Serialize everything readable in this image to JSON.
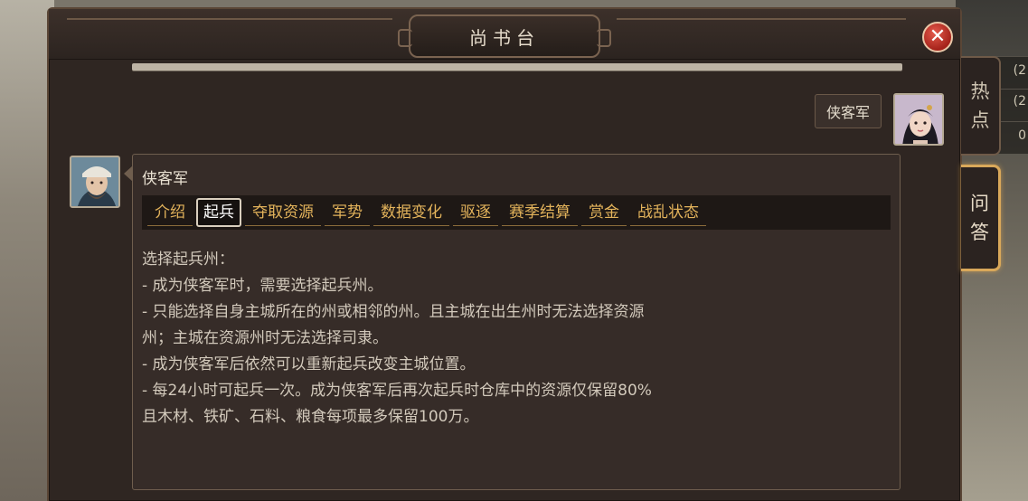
{
  "window": {
    "title": "尚书台",
    "close_label": "✕"
  },
  "side_tabs": {
    "hot": [
      "热",
      "点"
    ],
    "qa": [
      "问",
      "答"
    ]
  },
  "background": {
    "right_numbers": [
      "(2",
      "(2",
      "0"
    ]
  },
  "speaker": {
    "name": "侠客军"
  },
  "message": {
    "sender": "侠客军",
    "tabs": [
      "介绍",
      "起兵",
      "夺取资源",
      "军势",
      "数据变化",
      "驱逐",
      "赛季结算",
      "赏金",
      "战乱状态"
    ],
    "active_tab": "起兵",
    "lines": [
      "选择起兵州：",
      "- 成为侠客军时，需要选择起兵州。",
      "- 只能选择自身主城所在的州或相邻的州。且主城在出生州时无法选择资源",
      "州；主城在资源州时无法选择司隶。",
      "- 成为侠客军后依然可以重新起兵改变主城位置。",
      "- 每24小时可起兵一次。成为侠客军后再次起兵时仓库中的资源仅保留80%",
      "且木材、铁矿、石料、粮食每项最多保留100万。"
    ]
  },
  "colors": {
    "panel_bg": "#2f2622",
    "tab_text": "#e3b35b",
    "active_tab_text": "#ffffff",
    "body_text": "#d2c9bb",
    "close_red": "#c0392b",
    "qa_highlight": "#d9a85a"
  }
}
